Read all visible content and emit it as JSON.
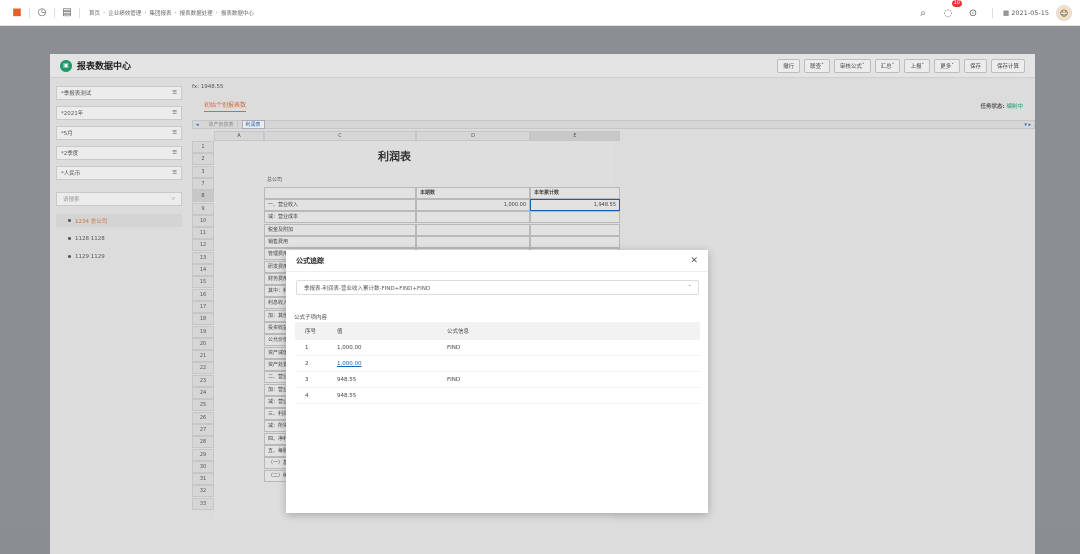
{
  "topbar": {
    "breadcrumbs": [
      "首页",
      "企业绩效管理",
      "集团报表",
      "报表数据处理",
      "报表数据中心"
    ],
    "notification_count": "10",
    "date": "2021-05-15"
  },
  "page": {
    "title": "报表数据中心",
    "toolbar": [
      "撤行",
      "联查",
      "审核公式",
      "汇总",
      "上报",
      "更多",
      "保存",
      "保存计算"
    ]
  },
  "sidebar": {
    "filters": [
      "*季报表测试",
      "*2021年",
      "*5月",
      "*2季度",
      "*人民币"
    ],
    "search_placeholder": "请搜索",
    "tree": [
      "1234 总公司",
      "1128 1128",
      "1129 1129"
    ]
  },
  "main": {
    "formula_bar": "fx: 1948.55",
    "report_tab": "初始个别报表数",
    "task_status_label": "任务状态:",
    "task_status_value": "编制中",
    "sheet_tabs": [
      "资产负债表",
      "利润表"
    ],
    "columns": [
      "A",
      "C",
      "D",
      "E"
    ],
    "rows": [
      "1",
      "2",
      "3",
      "7",
      "8",
      "9",
      "10",
      "11",
      "12",
      "13",
      "14",
      "15",
      "16",
      "17",
      "18",
      "19",
      "20",
      "21",
      "22",
      "23",
      "24",
      "25",
      "26",
      "27",
      "28",
      "29",
      "30",
      "31",
      "32",
      "33"
    ],
    "report_title": "利润表",
    "company": "总公司",
    "col_headers": [
      "本期数",
      "本年累计数"
    ],
    "items": [
      "一、营业收入",
      "减：营业成本",
      "税金及附加",
      "销售费用",
      "管理费用",
      "研发费用",
      "财务费用",
      "其中：利",
      "利息收入",
      "加：其他",
      "投资收益",
      "公允价值",
      "资产减值",
      "资产处置",
      "二、营业",
      "加：营业",
      "减：营业",
      "三、利润",
      "减：所得",
      "四、净利",
      "五、每股",
      "（一）基",
      "（二）稀"
    ],
    "current_period": "1,000.00",
    "ytd": "1,948.55"
  },
  "dialog": {
    "title": "公式追踪",
    "select_value": "季报表-利润表-营业收入累计数-FIND+FIND+FIND",
    "section_label": "公式子项内容",
    "headers": [
      "序号",
      "值",
      "公式信息"
    ],
    "rows": [
      {
        "no": "1",
        "value": "1,000.00",
        "info": "FIND"
      },
      {
        "no": "2",
        "value": "1,000.00",
        "info": ""
      },
      {
        "no": "3",
        "value": "948.55",
        "info": "FIND"
      },
      {
        "no": "4",
        "value": "948.55",
        "info": ""
      }
    ]
  }
}
